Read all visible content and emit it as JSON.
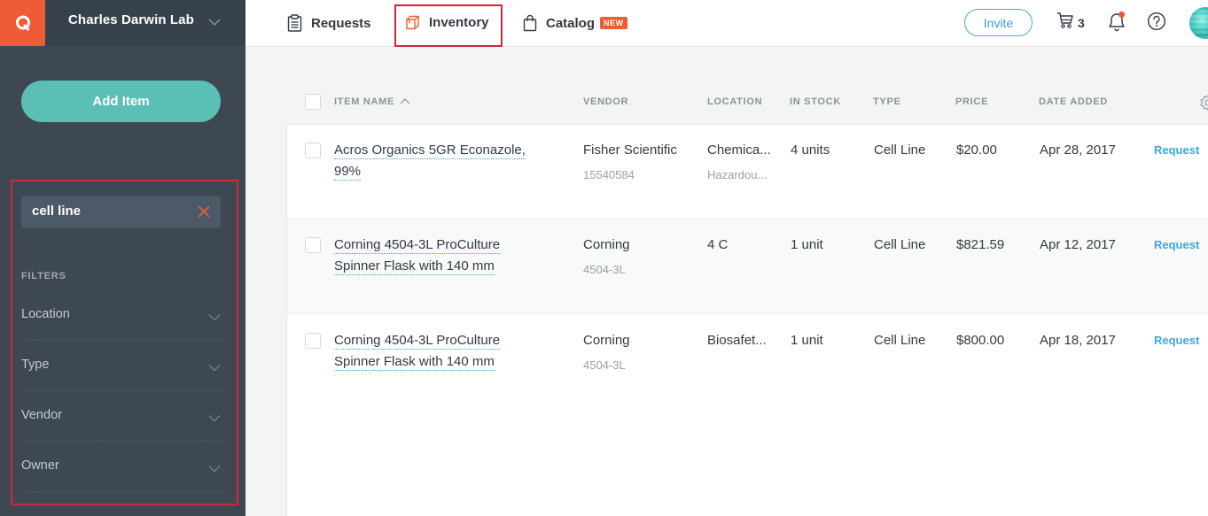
{
  "colors": {
    "brand_orange": "#ef5b36",
    "sidebar_bg": "#3d4853",
    "accent_teal": "#5bbfb6",
    "link_blue": "#3ea7dc",
    "highlight_red": "#d0283a"
  },
  "sidebar": {
    "logo_icon": "quartzy-q-logo",
    "lab_name": "Charles Darwin Lab",
    "add_item_label": "Add Item",
    "search": {
      "value": "cell line",
      "clear_icon": "close-x-icon"
    },
    "filters_title": "FILTERS",
    "filters": [
      {
        "label": "Location"
      },
      {
        "label": "Type"
      },
      {
        "label": "Vendor"
      },
      {
        "label": "Owner"
      }
    ]
  },
  "topnav": {
    "tabs": [
      {
        "label": "Requests",
        "icon": "clipboard-icon"
      },
      {
        "label": "Inventory",
        "icon": "box-icon",
        "active": true
      },
      {
        "label": "Catalog",
        "icon": "shopping-bag-icon",
        "badge": "NEW"
      }
    ],
    "invite_label": "Invite",
    "cart_count": "3",
    "notifications_dot": true
  },
  "table": {
    "columns": {
      "item_name": "ITEM NAME",
      "vendor": "VENDOR",
      "location": "LOCATION",
      "in_stock": "IN STOCK",
      "type": "TYPE",
      "price": "PRICE",
      "date_added": "DATE ADDED"
    },
    "sort": {
      "column": "item_name",
      "direction": "asc"
    },
    "rows": [
      {
        "name_line1": "Acros Organics 5GR Econazole,",
        "name_line2": "99%",
        "vendor": "Fisher Scientific",
        "catalog_no": "15540584",
        "location": "Chemica...",
        "sublocation": "Hazardou...",
        "in_stock": "4 units",
        "type": "Cell Line",
        "price": "$20.00",
        "date_added": "Apr 28, 2017",
        "action": "Request"
      },
      {
        "name_line1": "Corning 4504-3L ProCulture",
        "name_line2": "Spinner Flask with 140 mm",
        "vendor": "Corning",
        "catalog_no": "4504-3L",
        "location": "4 C",
        "sublocation": "",
        "in_stock": "1 unit",
        "type": "Cell Line",
        "price": "$821.59",
        "date_added": "Apr 12, 2017",
        "action": "Request"
      },
      {
        "name_line1": "Corning 4504-3L ProCulture",
        "name_line2": "Spinner Flask with 140 mm",
        "vendor": "Corning",
        "catalog_no": "4504-3L",
        "location": "Biosafet...",
        "sublocation": "",
        "in_stock": "1 unit",
        "type": "Cell Line",
        "price": "$800.00",
        "date_added": "Apr 18, 2017",
        "action": "Request"
      }
    ]
  }
}
